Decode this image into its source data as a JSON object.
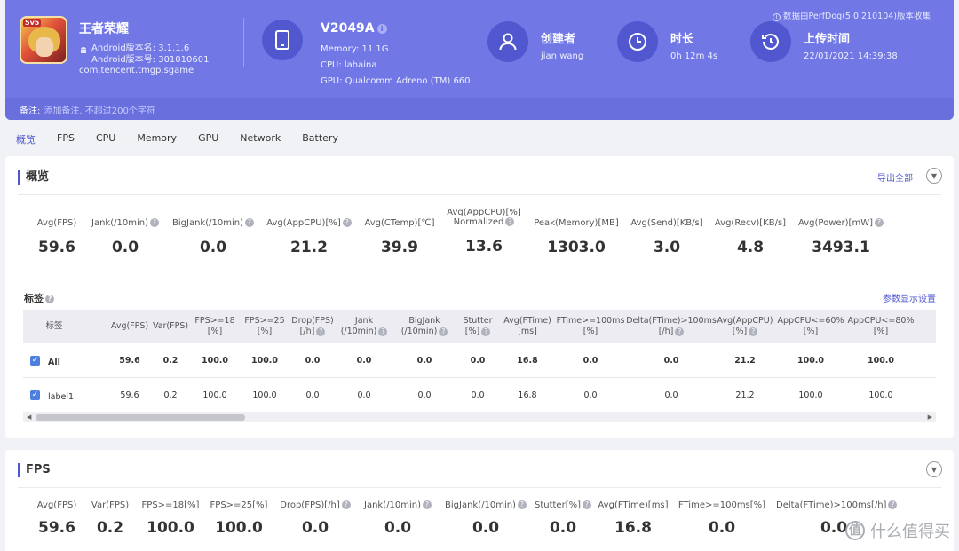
{
  "header": {
    "app": {
      "name": "王者荣耀",
      "icon_badge": "5v5",
      "version_name": "Android版本名: 3.1.1.6",
      "version_code": "Android版本号: 301010601",
      "package": "com.tencent.tmgp.sgame"
    },
    "device": {
      "name": "V2049A",
      "memory": "Memory: 11.1G",
      "cpu": "CPU: lahaina",
      "gpu": "GPU: Qualcomm Adreno (TM) 660"
    },
    "creator": {
      "title": "创建者",
      "value": "jian wang"
    },
    "duration": {
      "title": "时长",
      "value": "0h 12m 4s"
    },
    "upload": {
      "title": "上传时间",
      "value": "22/01/2021 14:39:38"
    },
    "source_note": "数据由PerfDog(5.0.210104)版本收集",
    "note_label": "备注:",
    "note_placeholder": "添加备注, 不超过200个字符"
  },
  "tabs": [
    "概览",
    "FPS",
    "CPU",
    "Memory",
    "GPU",
    "Network",
    "Battery"
  ],
  "overview": {
    "title": "概览",
    "export_label": "导出全部",
    "metrics": [
      {
        "label": "Avg(FPS)",
        "value": "59.6",
        "help": false
      },
      {
        "label": "Jank(/10min)",
        "value": "0.0",
        "help": true
      },
      {
        "label": "BigJank(/10min)",
        "value": "0.0",
        "help": true
      },
      {
        "label": "Avg(AppCPU)[%]",
        "value": "21.2",
        "help": true
      },
      {
        "label": "Avg(CTemp)[℃]",
        "value": "39.9",
        "help": false
      },
      {
        "label": "Avg(AppCPU)[%]",
        "label2": "Normalized",
        "value": "13.6",
        "help": true
      },
      {
        "label": "Peak(Memory)[MB]",
        "value": "1303.0",
        "help": false
      },
      {
        "label": "Avg(Send)[KB/s]",
        "value": "3.0",
        "help": false
      },
      {
        "label": "Avg(Recv)[KB/s]",
        "value": "4.8",
        "help": false
      },
      {
        "label": "Avg(Power)[mW]",
        "value": "3493.1",
        "help": true
      }
    ],
    "tags_label": "标签",
    "param_settings": "参数显示设置",
    "table": {
      "tag_header": "标签",
      "columns": [
        {
          "l1": "Avg(FPS)",
          "l2": "",
          "help": false
        },
        {
          "l1": "Var(FPS)",
          "l2": "",
          "help": false
        },
        {
          "l1": "FPS>=18",
          "l2": "[%]",
          "help": false
        },
        {
          "l1": "FPS>=25",
          "l2": "[%]",
          "help": false
        },
        {
          "l1": "Drop(FPS)",
          "l2": "[/h]",
          "help": true
        },
        {
          "l1": "Jank",
          "l2": "(/10min)",
          "help": true
        },
        {
          "l1": "BigJank",
          "l2": "(/10min)",
          "help": true
        },
        {
          "l1": "Stutter",
          "l2": "[%]",
          "help": true
        },
        {
          "l1": "Avg(FTime)",
          "l2": "[ms]",
          "help": false
        },
        {
          "l1": "FTime>=100ms",
          "l2": "[%]",
          "help": false
        },
        {
          "l1": "Delta(FTime)>100ms",
          "l2": "[/h]",
          "help": true
        },
        {
          "l1": "Avg(AppCPU)",
          "l2": "[%]",
          "help": true
        },
        {
          "l1": "AppCPU<=60%",
          "l2": "[%]",
          "help": false
        },
        {
          "l1": "AppCPU<=80%",
          "l2": "[%]",
          "help": false
        }
      ],
      "rows": [
        {
          "tag": "All",
          "values": [
            "59.6",
            "0.2",
            "100.0",
            "100.0",
            "0.0",
            "0.0",
            "0.0",
            "0.0",
            "16.8",
            "0.0",
            "0.0",
            "21.2",
            "100.0",
            "100.0"
          ]
        },
        {
          "tag": "label1",
          "values": [
            "59.6",
            "0.2",
            "100.0",
            "100.0",
            "0.0",
            "0.0",
            "0.0",
            "0.0",
            "16.8",
            "0.0",
            "0.0",
            "21.2",
            "100.0",
            "100.0"
          ]
        }
      ]
    }
  },
  "fps_section": {
    "title": "FPS",
    "metrics": [
      {
        "label": "Avg(FPS)",
        "value": "59.6",
        "help": false
      },
      {
        "label": "Var(FPS)",
        "value": "0.2",
        "help": false
      },
      {
        "label": "FPS>=18[%]",
        "value": "100.0",
        "help": false
      },
      {
        "label": "FPS>=25[%]",
        "value": "100.0",
        "help": false
      },
      {
        "label": "Drop(FPS)[/h]",
        "value": "0.0",
        "help": true
      },
      {
        "label": "Jank(/10min)",
        "value": "0.0",
        "help": true
      },
      {
        "label": "BigJank(/10min)",
        "value": "0.0",
        "help": true
      },
      {
        "label": "Stutter[%]",
        "value": "0.0",
        "help": true
      },
      {
        "label": "Avg(FTime)[ms]",
        "value": "16.8",
        "help": false
      },
      {
        "label": "FTime>=100ms[%]",
        "value": "0.0",
        "help": false
      },
      {
        "label": "Delta(FTime)>100ms[/h]",
        "value": "0.0",
        "help": true
      }
    ]
  },
  "watermark": {
    "glyph": "值",
    "text": "什么值得买"
  }
}
